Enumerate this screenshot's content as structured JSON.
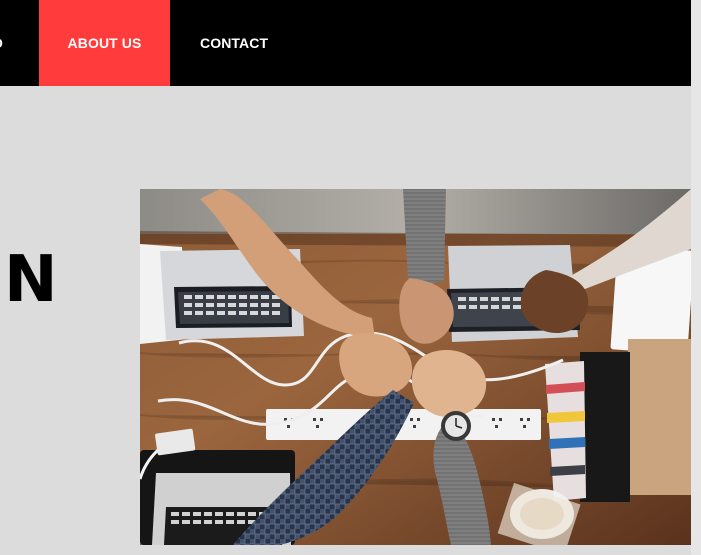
{
  "nav": {
    "items": [
      {
        "label": "O"
      },
      {
        "label": "ABOUT US"
      },
      {
        "label": "CONTACT"
      }
    ],
    "active_color": "#ff3b3b"
  },
  "hero": {
    "title_fragment": "N"
  },
  "photo": {
    "subject": "team fist bump over laptops"
  }
}
